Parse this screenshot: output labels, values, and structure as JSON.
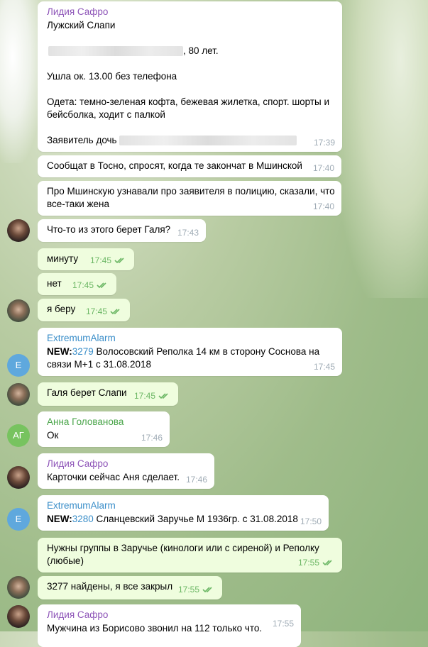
{
  "messages": {
    "m1": {
      "sender": "Лидия Сафро",
      "line1": "Лужский Слапи",
      "line2_suffix": ", 80 лет.",
      "line3": "Ушла ок. 13.00 без телефона",
      "line4": "Одета: темно-зеленая кофта, бежевая жилетка, спорт. шорты и",
      "line5": "бейсболка, ходит с палкой",
      "line6_prefix": "Заявитель дочь",
      "time": "17:39"
    },
    "m2": {
      "text": "Сообщат в Тосно, спросят, когда те закончат в Мшинской",
      "time": "17:40"
    },
    "m3": {
      "line1": "Про Мшинскую узнавали про заявителя в полицию, сказали, что",
      "line2": "все-таки жена",
      "time": "17:40"
    },
    "m4": {
      "text": "Что-то из этого берет Галя?",
      "time": "17:43"
    },
    "m5": {
      "text": "минуту",
      "time": "17:45"
    },
    "m6": {
      "text": "нет",
      "time": "17:45"
    },
    "m7": {
      "text": "я беру",
      "time": "17:45"
    },
    "m8": {
      "sender": "ExtremumAlarm",
      "new_label": "NEW:",
      "link": "3279",
      "line1_rest": " Волосовский Реполка 14 км в сторону Соснова на",
      "line2": "связи М+1 с 31.08.2018",
      "time": "17:45",
      "avatar_letter": "E"
    },
    "m9": {
      "text": "Галя берет Слапи",
      "time": "17:45"
    },
    "m10": {
      "sender": "Анна Голованова",
      "text": "Ок",
      "time": "17:46",
      "avatar_letter": "АГ"
    },
    "m11": {
      "sender": "Лидия Сафро",
      "text": "Карточки сейчас Аня сделает.",
      "time": "17:46"
    },
    "m12": {
      "sender": "ExtremumAlarm",
      "new_label": "NEW:",
      "link": "3280",
      "line1_rest": "  Сланцевский Заручье  М 1936гр. с 31.08.2018",
      "time": "17:50",
      "avatar_letter": "E"
    },
    "m13": {
      "line1": "Нужны группы в Заручье (кинологи или с сиреной) и Реполку",
      "line2": "(любые)",
      "time": "17:55"
    },
    "m14": {
      "text": "3277 найдены, я все закрыл",
      "time": "17:55"
    },
    "m15": {
      "sender": "Лидия Сафро",
      "text": "Мужчина из Борисово звонил на 112 только что.",
      "time": "17:55"
    }
  },
  "colors": {
    "incoming_bubble": "#ffffff",
    "outgoing_bubble": "#effdde",
    "sender_violet": "#8e55b8",
    "sender_blue": "#3a8ec9",
    "sender_green": "#4aa54a",
    "read_check": "#6cb765"
  },
  "icons": {
    "read_status": "double-check-icon"
  }
}
